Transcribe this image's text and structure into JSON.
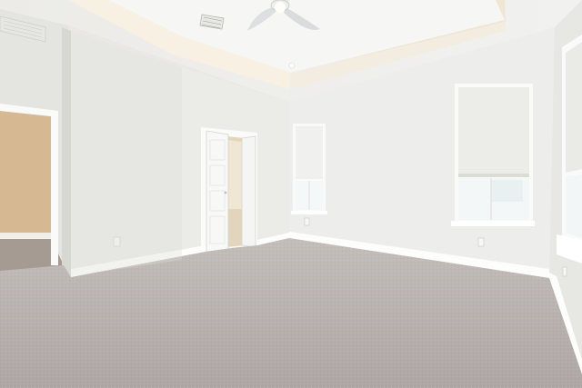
{
  "scene": {
    "type": "empty bedroom interior photo",
    "colors": {
      "ceiling": "#f3f3f1",
      "tray_ceiling": "#f7f7f5",
      "wall_left": "#e6e6e2",
      "wall_center": "#ececea",
      "wall_right": "#eeeeec",
      "trim": "#ffffff",
      "carpet": "#b9b2b0",
      "hallway_wall": "#d7b994",
      "hallway_floor": "#a69c94",
      "window_glass": "#f4f7f8",
      "window_shade": "#edeeea",
      "door": "#f7f7f5"
    }
  }
}
